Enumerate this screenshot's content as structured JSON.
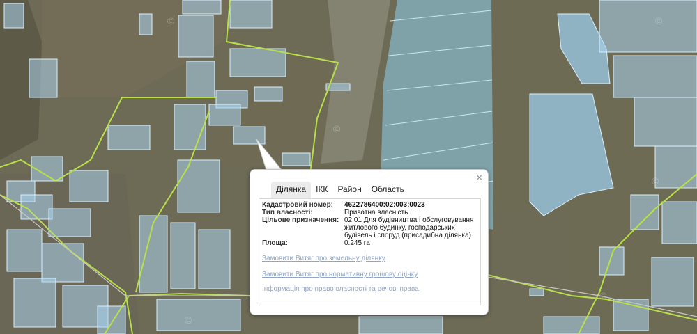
{
  "map": {
    "watermark": "©",
    "land_color": "#6b6752",
    "field_color": "#7aa0b0",
    "parcel_fill": "#a9d4ee",
    "parcel_stroke": "#d9efff",
    "boundary_color": "#b9e04a"
  },
  "popup": {
    "close_label": "×",
    "tabs": [
      {
        "label": "Ділянка",
        "active": true
      },
      {
        "label": "ІКК",
        "active": false
      },
      {
        "label": "Район",
        "active": false
      },
      {
        "label": "Область",
        "active": false
      }
    ],
    "fields": {
      "cadastral_label": "Кадастровий номер:",
      "cadastral_value": "4622786400:02:003:0023",
      "ownership_label": "Тип власності:",
      "ownership_value": "Приватна власність",
      "purpose_label": "Цільове призначення:",
      "purpose_value": "02.01 Для будівництва і обслуговування житлового будинку, господарських будівель і споруд (присадибна ділянка)",
      "area_label": "Площа:",
      "area_value": "0.245 га"
    },
    "links": [
      "Замовити Витяг про земельну ділянку",
      "Замовити Витяг про нормативну грошову оцінку",
      "Інформація про право власності та речові права"
    ]
  }
}
